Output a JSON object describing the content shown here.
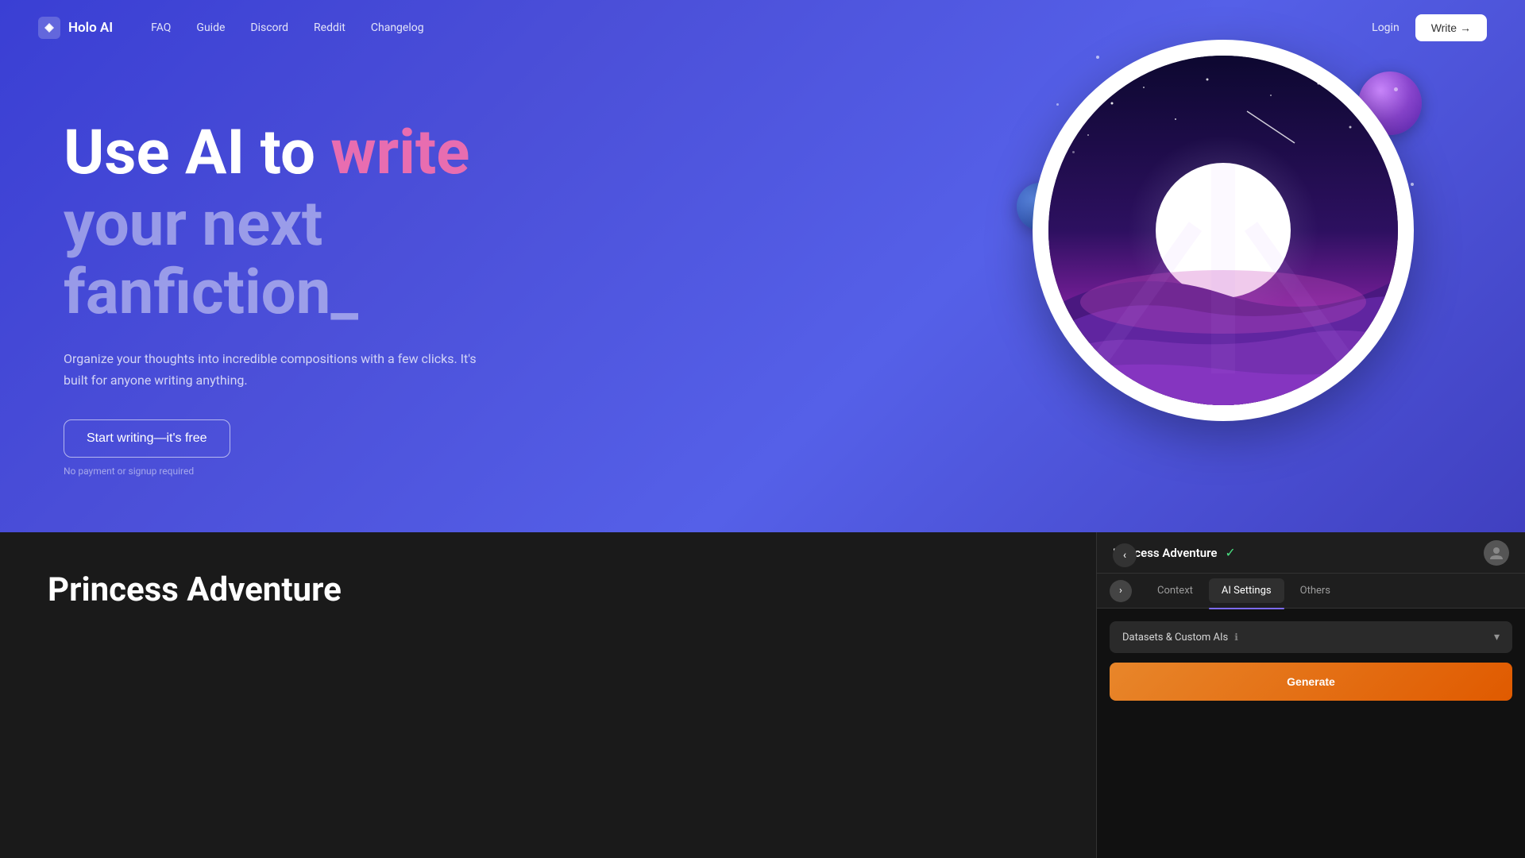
{
  "nav": {
    "logo_text": "Holo AI",
    "links": [
      {
        "label": "FAQ",
        "id": "faq"
      },
      {
        "label": "Guide",
        "id": "guide"
      },
      {
        "label": "Discord",
        "id": "discord"
      },
      {
        "label": "Reddit",
        "id": "reddit"
      },
      {
        "label": "Changelog",
        "id": "changelog"
      }
    ],
    "login_label": "Login",
    "write_button": "Write →"
  },
  "hero": {
    "title_line1_prefix": "Use AI to ",
    "title_line1_highlight": "write",
    "title_line2": "your next fanfiction_",
    "subtitle": "Organize your thoughts into incredible compositions with a few clicks. It's built for anyone writing anything.",
    "cta_button": "Start writing—it's free",
    "no_payment": "No payment or signup required"
  },
  "panel": {
    "back_icon": "‹",
    "story_name": "Princess Adventure",
    "check_icon": "✓",
    "tabs": [
      {
        "label": "Context",
        "id": "context"
      },
      {
        "label": "AI Settings",
        "id": "ai-settings",
        "active": true
      },
      {
        "label": "Others",
        "id": "others"
      }
    ],
    "arrow_icon": "›",
    "section_title": "Datasets & Custom AIs",
    "section_info_icon": "ℹ",
    "chevron_icon": "▾",
    "story_title": "Princess Adventure",
    "orange_button": "Generate"
  },
  "colors": {
    "hero_bg": "#4a4fd4",
    "tab_active_underline": "#7c6af7",
    "write_highlight": "#e86db0",
    "check_green": "#4ade80",
    "orange_btn": "#e8762a"
  }
}
